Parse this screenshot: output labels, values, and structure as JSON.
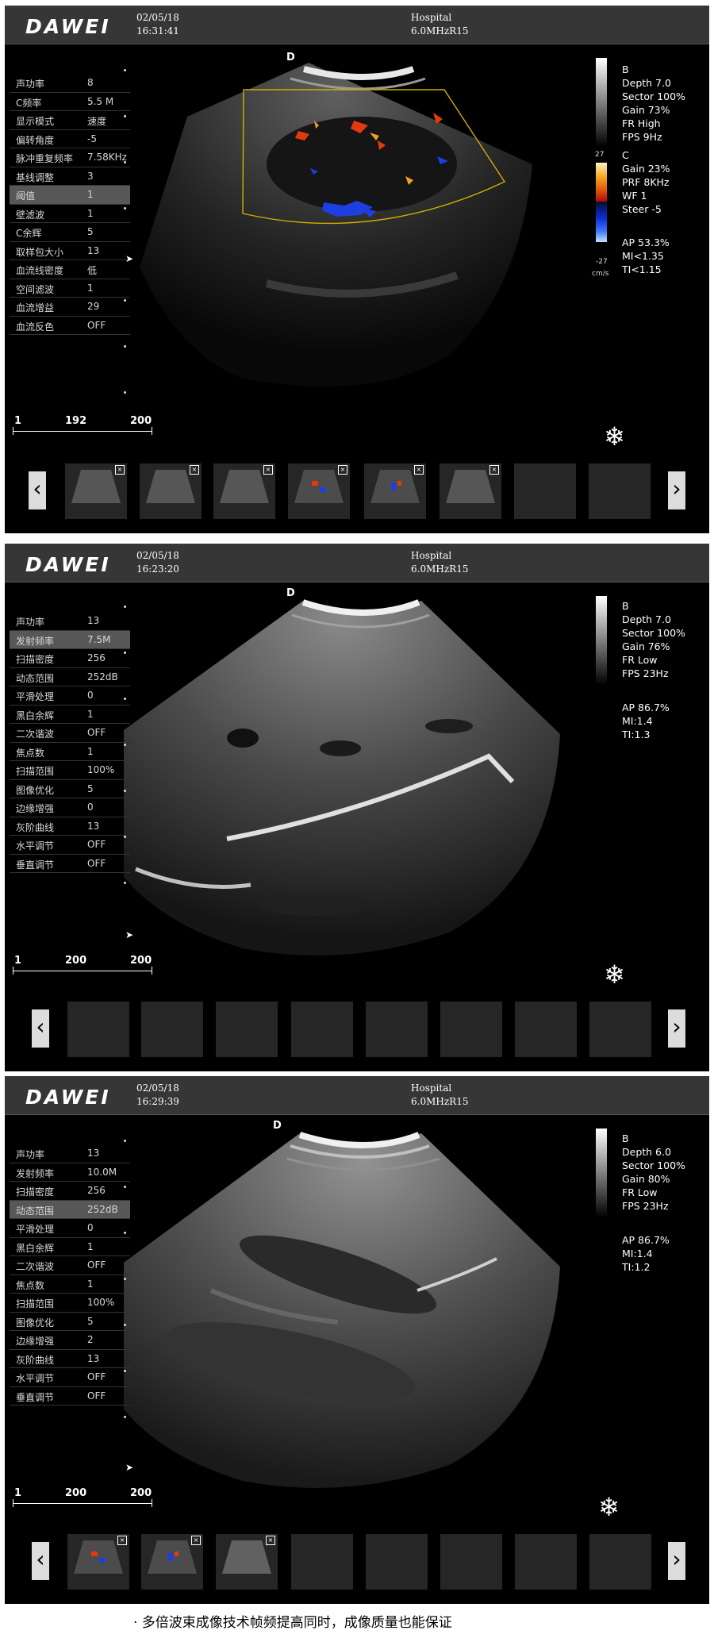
{
  "brand": "DAWEI",
  "screens": [
    {
      "date": "02/05/18",
      "time": "16:31:41",
      "hospital": "Hospital",
      "probe": "6.0MHzR15",
      "d_mark": "D",
      "params": [
        {
          "label": "声功率",
          "value": "8"
        },
        {
          "label": "C频率",
          "value": "5.5 M"
        },
        {
          "label": "显示模式",
          "value": "速度"
        },
        {
          "label": "偏转角度",
          "value": "-5"
        },
        {
          "label": "脉冲重复频率",
          "value": "7.58KHz"
        },
        {
          "label": "基线调整",
          "value": "3"
        },
        {
          "label": "阈值",
          "value": "1"
        },
        {
          "label": "壁滤波",
          "value": "1"
        },
        {
          "label": "C余辉",
          "value": "5"
        },
        {
          "label": "取样包大小",
          "value": "13"
        },
        {
          "label": "血流线密度",
          "value": "低"
        },
        {
          "label": "空间滤波",
          "value": "1"
        },
        {
          "label": "血流增益",
          "value": "29"
        },
        {
          "label": "血流反色",
          "value": "OFF"
        }
      ],
      "highlight_index": 6,
      "right_info_b": [
        "B",
        "Depth 7.0",
        "Sector 100%",
        "Gain 73%",
        "FR High",
        "FPS 9Hz"
      ],
      "right_info_c": [
        "C",
        "Gain  23%",
        "PRF 8KHz",
        "WF 1",
        "Steer -5"
      ],
      "color_scale_top": "27",
      "color_scale_bottom": "-27",
      "color_scale_unit": "cm/s",
      "right_info_safety": [
        "AP 53.3%",
        "MI<1.35",
        "TI<1.15"
      ],
      "scale": {
        "left": "1",
        "mid": "192",
        "right": "200"
      }
    },
    {
      "date": "02/05/18",
      "time": "16:23:20",
      "hospital": "Hospital",
      "probe": "6.0MHzR15",
      "d_mark": "D",
      "params": [
        {
          "label": "声功率",
          "value": "13"
        },
        {
          "label": "发射频率",
          "value": "7.5M"
        },
        {
          "label": "扫描密度",
          "value": "256"
        },
        {
          "label": "动态范围",
          "value": "252dB"
        },
        {
          "label": "平滑处理",
          "value": "0"
        },
        {
          "label": "黑白余辉",
          "value": "1"
        },
        {
          "label": "二次谐波",
          "value": "OFF"
        },
        {
          "label": "焦点数",
          "value": "1"
        },
        {
          "label": "扫描范围",
          "value": "100%"
        },
        {
          "label": "图像优化",
          "value": "5"
        },
        {
          "label": "边缘增强",
          "value": "0"
        },
        {
          "label": "灰阶曲线",
          "value": "13"
        },
        {
          "label": "水平调节",
          "value": "OFF"
        },
        {
          "label": "垂直调节",
          "value": "OFF"
        }
      ],
      "highlight_index": 1,
      "right_info_b": [
        "B",
        "Depth 7.0",
        "Sector 100%",
        "Gain 76%",
        "FR Low",
        "FPS 23Hz"
      ],
      "right_info_safety": [
        "AP 86.7%",
        "MI:1.4",
        "TI:1.3"
      ],
      "scale": {
        "left": "1",
        "mid": "200",
        "right": "200"
      }
    },
    {
      "date": "02/05/18",
      "time": "16:29:39",
      "hospital": "Hospital",
      "probe": "6.0MHzR15",
      "d_mark": "D",
      "params": [
        {
          "label": "声功率",
          "value": "13"
        },
        {
          "label": "发射频率",
          "value": "10.0M"
        },
        {
          "label": "扫描密度",
          "value": "256"
        },
        {
          "label": "动态范围",
          "value": "252dB"
        },
        {
          "label": "平滑处理",
          "value": "0"
        },
        {
          "label": "黑白余辉",
          "value": "1"
        },
        {
          "label": "二次谐波",
          "value": "OFF"
        },
        {
          "label": "焦点数",
          "value": "1"
        },
        {
          "label": "扫描范围",
          "value": "100%"
        },
        {
          "label": "图像优化",
          "value": "5"
        },
        {
          "label": "边缘增强",
          "value": "2"
        },
        {
          "label": "灰阶曲线",
          "value": "13"
        },
        {
          "label": "水平调节",
          "value": "OFF"
        },
        {
          "label": "垂直调节",
          "value": "OFF"
        }
      ],
      "highlight_index": 3,
      "right_info_b": [
        "B",
        "Depth 6.0",
        "Sector 100%",
        "Gain 80%",
        "FR Low",
        "FPS 23Hz"
      ],
      "right_info_safety": [
        "AP 86.7%",
        "MI:1.4",
        "TI:1.2"
      ],
      "scale": {
        "left": "1",
        "mid": "200",
        "right": "200"
      }
    }
  ],
  "caption": "· 多倍波束成像技术帧频提高同时，成像质量也能保证"
}
